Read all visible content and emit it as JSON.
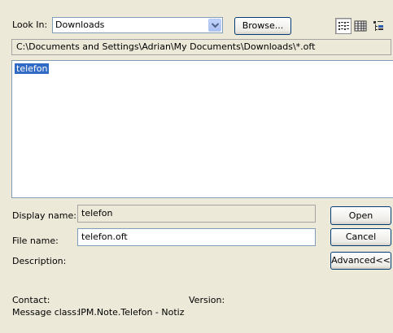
{
  "look_in": {
    "label": "Look In:",
    "value": "Downloads"
  },
  "toolbar": {
    "browse_label": "Browse..."
  },
  "path": "C:\\Documents and Settings\\Adrian\\My Documents\\Downloads\\*.oft",
  "files": [
    "telefon"
  ],
  "form": {
    "display_name_label": "Display name:",
    "display_name_value": "telefon",
    "file_name_label": "File name:",
    "file_name_value": "telefon.oft",
    "description_label": "Description:"
  },
  "buttons": {
    "open": "Open",
    "cancel": "Cancel",
    "advanced": "Advanced<<"
  },
  "info": {
    "contact_label": "Contact:",
    "version_label": "Version:",
    "message_class_label": "Message class:",
    "message_class_value": "IPM.Note.Telefon - Notiz"
  },
  "icons": {
    "view_list": "list-view-icon",
    "view_details": "details-view-icon",
    "view_properties": "properties-view-icon"
  }
}
